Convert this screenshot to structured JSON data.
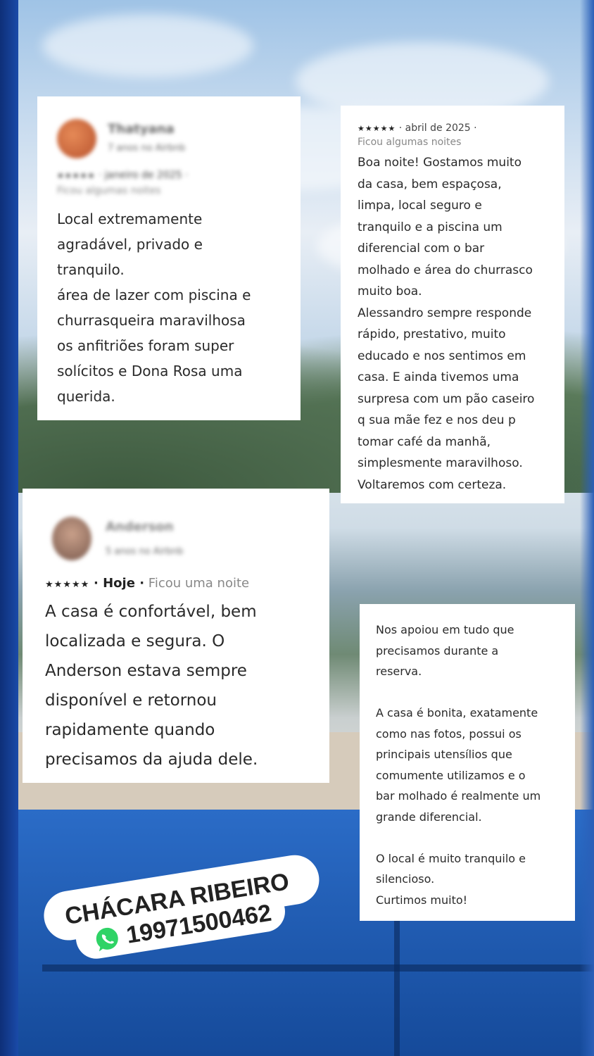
{
  "review1": {
    "name": "Thatyana",
    "subtitle": "7 anos no Airbnb",
    "stars": "★★★★★",
    "date": "· janeiro de 2025 ·",
    "stay": "Ficou algumas noites",
    "text": "Local extremamente\nagradável, privado e\ntranquilo.\nárea de lazer com piscina e\nchurrasqueira maravilhosa\nos anfitriões foram super\nsolícitos e Dona Rosa uma\nquerida."
  },
  "review2": {
    "stars": "★★★★★",
    "date": "· abril de 2025 ·",
    "stay": "Ficou algumas noites",
    "text": "Boa noite! Gostamos muito\nda casa, bem espaçosa,\nlimpa, local seguro e\ntranquilo e a  piscina um\ndiferencial com o bar\nmolhado e área do churrasco\nmuito boa.\nAlessandro sempre responde\nrápido, prestativo, muito\neducado e nos sentimos em\ncasa. E ainda tivemos uma\nsurpresa com um pão caseiro\nq sua mãe fez e nos deu p\ntomar café da manhã,\nsimplesmente maravilhoso.\nVoltaremos com certeza."
  },
  "review3": {
    "name": "Anderson",
    "subtitle": "5 anos no Airbnb",
    "stars": "★★★★★",
    "date": "· Hoje ·",
    "stay": "Ficou uma noite",
    "text": "A casa é confortável,  bem\nlocalizada e segura. O\nAnderson estava sempre\ndisponível e retornou\nrapidamente quando\nprecisamos da ajuda dele."
  },
  "review4": {
    "text": "Nos apoiou em tudo que\nprecisamos durante a\nreserva.\n\nA casa é bonita, exatamente\ncomo nas fotos, possui os\nprincipais utensílios que\ncomumente utilizamos e o\nbar molhado é realmente um\ngrande diferencial.\n\nO local é muito tranquilo e\nsilencioso.\nCurtimos muito!"
  },
  "promo": {
    "title": "CHÁCARA RIBEIRO",
    "phone": "19971500462",
    "icon": "whatsapp-icon"
  }
}
